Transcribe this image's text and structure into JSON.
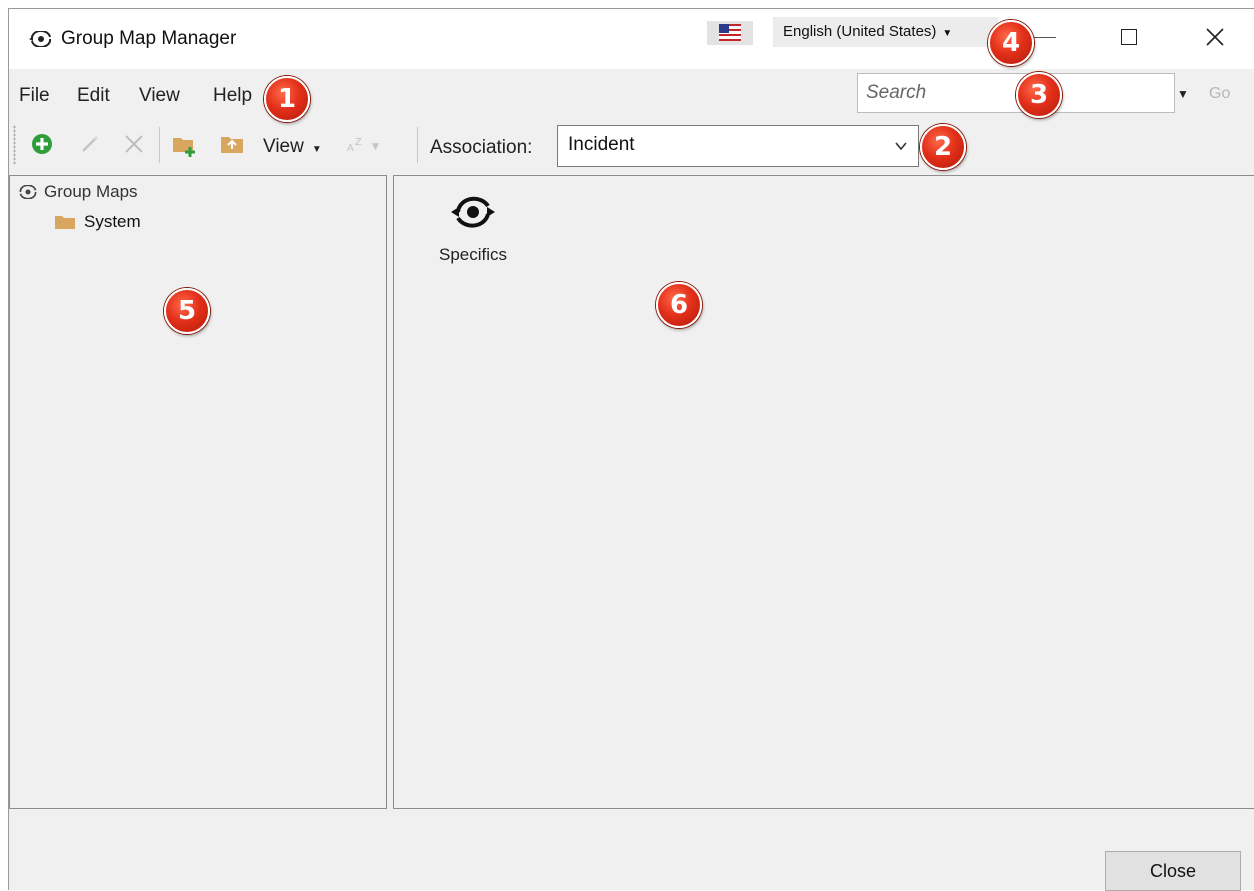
{
  "window": {
    "title": "Group Map Manager",
    "language": "English (United States)"
  },
  "menu": {
    "items": [
      "File",
      "Edit",
      "View",
      "Help"
    ],
    "search_placeholder": "Search",
    "go_label": "Go"
  },
  "toolbar": {
    "view_label": "View",
    "association_label": "Association:",
    "association_value": "Incident"
  },
  "tree": {
    "root": "Group Maps",
    "children": [
      "System"
    ]
  },
  "content": {
    "items": [
      {
        "label": "Specifics",
        "icon": "group-map-icon"
      }
    ]
  },
  "footer": {
    "close_label": "Close"
  },
  "callouts": [
    "1",
    "2",
    "3",
    "4",
    "5",
    "6"
  ],
  "colors": {
    "callout": "#e3301a",
    "add_icon": "#2e9d3a",
    "folder": "#d9a660",
    "pane_bg": "#f0f0f0"
  }
}
